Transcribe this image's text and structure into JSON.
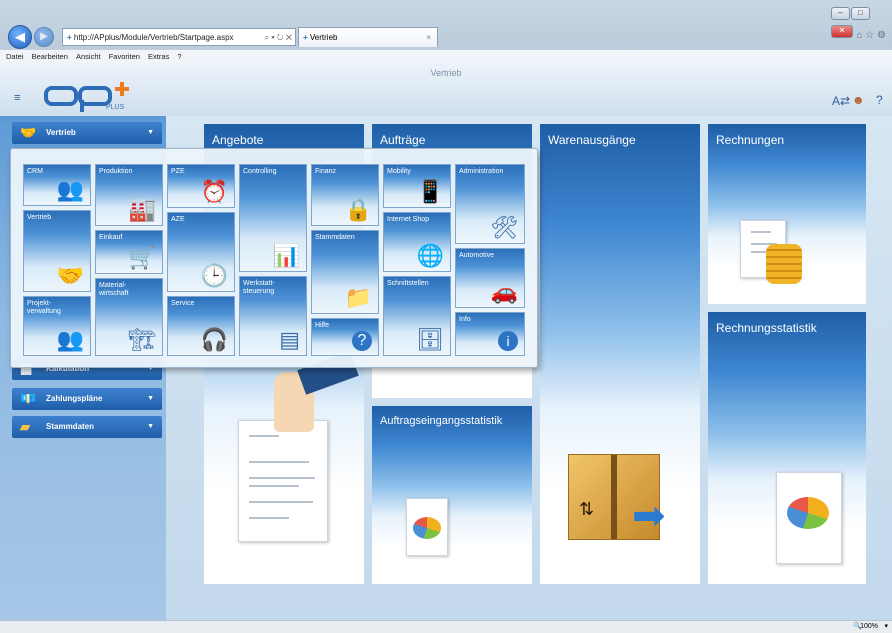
{
  "browser": {
    "address": "http://APplus/Module/Vertrieb/Startpage.aspx",
    "address_controls": "⌕ ▾ ↻ ✕",
    "tab_title": "Vertrieb",
    "menu": [
      "Datei",
      "Bearbeiten",
      "Ansicht",
      "Favoriten",
      "Extras",
      "?"
    ]
  },
  "app": {
    "title": "Vertrieb",
    "logo_text": "ap",
    "logo_sub": "PLUS"
  },
  "sidebar": {
    "items": [
      {
        "label": "Vertrieb",
        "icon": "handshake-icon"
      },
      {
        "label": "Kalkulation",
        "icon": "calculator-icon"
      },
      {
        "label": "Zahlungspläne",
        "icon": "money-icon"
      },
      {
        "label": "Stammdaten",
        "icon": "folder-icon"
      }
    ]
  },
  "tiles": {
    "angebote": "Angebote",
    "auftraege": "Aufträge",
    "warenausgaenge": "Warenausgänge",
    "rechnungen": "Rechnungen",
    "rechnungsstatistik": "Rechnungsstatistik",
    "auftragseingangsstatistik": "Auftragseingangsstatistik"
  },
  "module_menu": [
    {
      "label": "CRM",
      "icon": "people-icon"
    },
    {
      "label": "Produktion",
      "icon": "factory-icon"
    },
    {
      "label": "PZE",
      "icon": "clock-person-icon"
    },
    {
      "label": "Controlling",
      "icon": "chart-person-icon"
    },
    {
      "label": "Finanz",
      "icon": "safe-icon"
    },
    {
      "label": "Mobility",
      "icon": "phone-icon"
    },
    {
      "label": "Administration",
      "icon": "tools-icon"
    },
    {
      "label": "Vertrieb",
      "icon": "handshake-icon"
    },
    {
      "label": "Einkauf",
      "icon": "cart-icon"
    },
    {
      "label": "AZE",
      "icon": "clock-icon"
    },
    {
      "label": "Stammdaten",
      "icon": "folders-icon"
    },
    {
      "label": "Internet Shop",
      "icon": "globe-cart-icon"
    },
    {
      "label": "Automotive",
      "icon": "car-icon"
    },
    {
      "label": "Material-\nwirtschaft",
      "icon": "forklift-icon"
    },
    {
      "label": "Service",
      "icon": "headset-icon"
    },
    {
      "label": "Werkstatt-\nsteuerung",
      "icon": "gantt-icon"
    },
    {
      "label": "Schnittstellen",
      "icon": "database-icon"
    },
    {
      "label": "Projekt-\nverwaltung",
      "icon": "team-icon"
    },
    {
      "label": "Hilfe",
      "icon": "help-icon"
    },
    {
      "label": "Info",
      "icon": "info-icon"
    }
  ],
  "status": {
    "zoom": "100%"
  },
  "colors": {
    "tile_dark": "#1e5ea6",
    "sidebar": "#3e82cf",
    "accent": "#1d5fbf"
  }
}
